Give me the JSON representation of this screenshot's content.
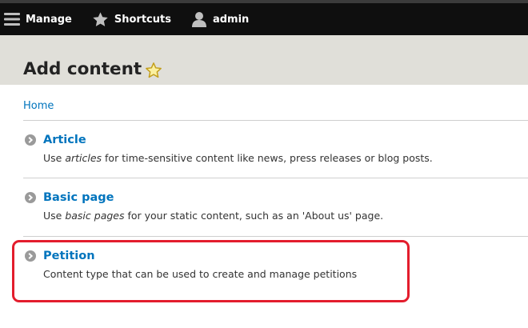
{
  "toolbar": {
    "manage_label": "Manage",
    "shortcuts_label": "Shortcuts",
    "user_label": "admin",
    "icons": [
      "hamburger-icon",
      "star-icon",
      "user-icon"
    ]
  },
  "page": {
    "title": "Add content",
    "title_icon": "star-outline-icon"
  },
  "breadcrumb": {
    "home_label": "Home"
  },
  "content_types": [
    {
      "title": "Article",
      "desc_before": "Use ",
      "desc_em": "articles",
      "desc_after": " for time-sensitive content like news, press releases or blog posts."
    },
    {
      "title": "Basic page",
      "desc_before": "Use ",
      "desc_em": "basic pages",
      "desc_after": " for your static content, such as an 'About us' page."
    },
    {
      "title": "Petition",
      "desc_before": "Content type that can be used to create and manage petitions",
      "desc_em": "",
      "desc_after": ""
    }
  ],
  "colors": {
    "toolbar_bg": "#0f0f0f",
    "header_bg": "#e0dfd9",
    "link": "#0074bd",
    "highlight": "#e31d2d"
  }
}
